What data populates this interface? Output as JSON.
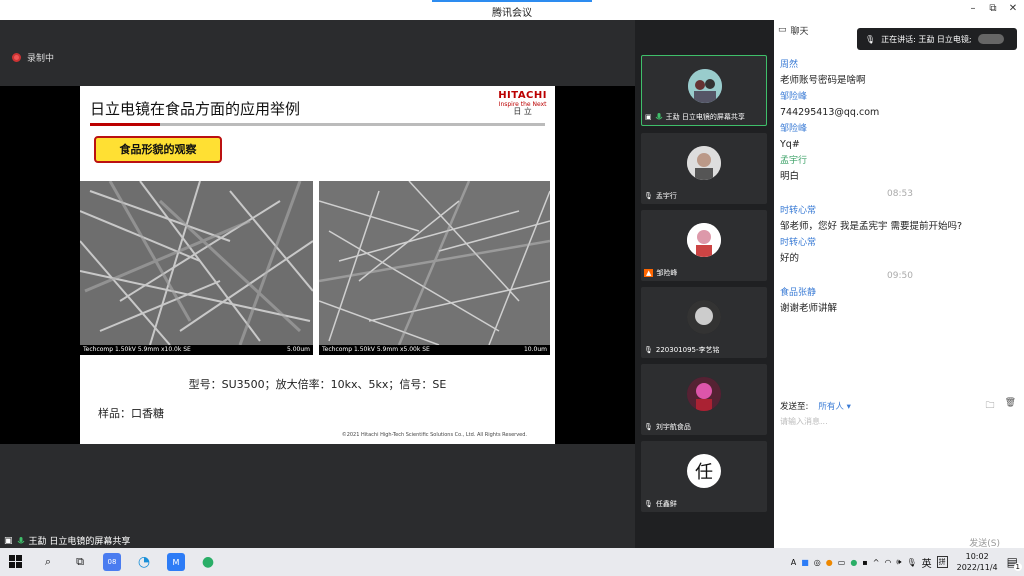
{
  "window": {
    "title": "腾讯会议",
    "minimize": "–",
    "restore": "⧉",
    "close": "✕"
  },
  "stage": {
    "recording_label": "录制中"
  },
  "slide": {
    "title": "日立电镜在食品方面的应用举例",
    "logo_line1": "HITACHI",
    "logo_line2": "Inspire the Next",
    "logo_line3": "日 立",
    "tag": "食品形貌的观察",
    "images": [
      {
        "cap_left": "Techcomp 1.50kV 5.9mm x10.0k SE",
        "cap_right": "5.00um"
      },
      {
        "cap_left": "Techcomp 1.50kV 5.9mm x5.00k SE",
        "cap_right": "10.0um"
      }
    ],
    "spec": "型号：SU3500；放大倍率：10kx、5kx；信号：SE",
    "sample": "样品：口香糖",
    "copyright": "©2021 Hitachi High-Tech Scientific Solutions Co., Ltd. All Rights Reserved."
  },
  "share_label": "王勐 日立电镜的屏幕共享",
  "participants": [
    {
      "name": "王勐 日立电镜的屏幕共享",
      "avatar": ""
    },
    {
      "name": "孟宇行",
      "avatar": ""
    },
    {
      "name": "邹险峰",
      "avatar": ""
    },
    {
      "name": "220301095-李艺铭",
      "avatar": ""
    },
    {
      "name": "刘宇航食品",
      "avatar": ""
    },
    {
      "name": "任鑫鲜",
      "avatar": "任"
    }
  ],
  "chat": {
    "header": "聊天",
    "speaking": "正在讲话: 王勐 日立电镜;",
    "messages": [
      {
        "sender": "周然",
        "text": "老师账号密码是啥啊"
      },
      {
        "sender": "邹险峰",
        "text": "744295413@qq.com"
      },
      {
        "sender": "邹险峰",
        "text": "Yq#"
      },
      {
        "sender": "孟宇行",
        "text": "明白"
      }
    ],
    "time1": "08:53",
    "messages2": [
      {
        "sender": "时转心常",
        "text": "邹老师，您好 我是孟宪宇 需要提前开始吗?"
      },
      {
        "sender": "时转心常",
        "text": "好的"
      }
    ],
    "time2": "09:50",
    "messages3": [
      {
        "sender": "食品张静",
        "text": "谢谢老师讲解"
      }
    ],
    "send_to_label": "发送至:",
    "send_to_value": "所有人 ▾",
    "placeholder": "请输入消息...",
    "send_button": "发送(S)"
  },
  "taskbar": {
    "ime": "英",
    "ime2": "拼",
    "time": "10:02",
    "date": "2022/11/4",
    "notifications": "1"
  }
}
